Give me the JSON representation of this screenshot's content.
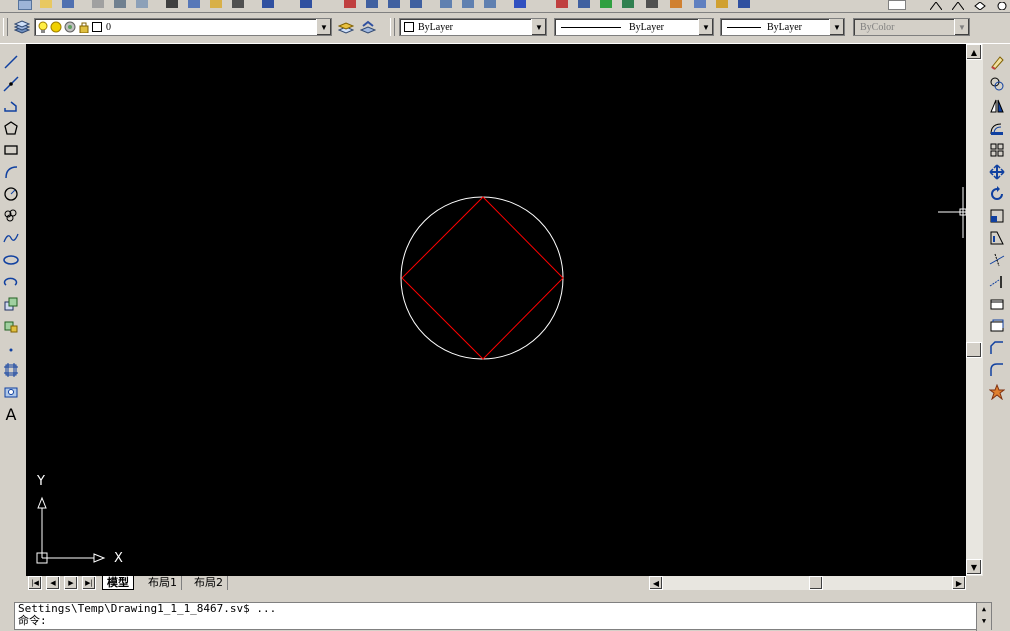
{
  "layers_toolbar": {
    "layer_combo_value": "0"
  },
  "properties_toolbar": {
    "color_value": "ByLayer",
    "linetype_value": "ByLayer",
    "lineweight_value": "ByLayer",
    "plotstyle_value": "ByColor"
  },
  "drawing": {
    "ucs_x_label": "X",
    "ucs_y_label": "Y",
    "circle_color": "#ffffff",
    "square_color": "#ff0000"
  },
  "tabs": {
    "model": "模型",
    "layout1": "布局1",
    "layout2": "布局2"
  },
  "command": {
    "line1": "Settings\\Temp\\Drawing1_1_1_8467.sv$ ...",
    "line2": "命令:"
  }
}
